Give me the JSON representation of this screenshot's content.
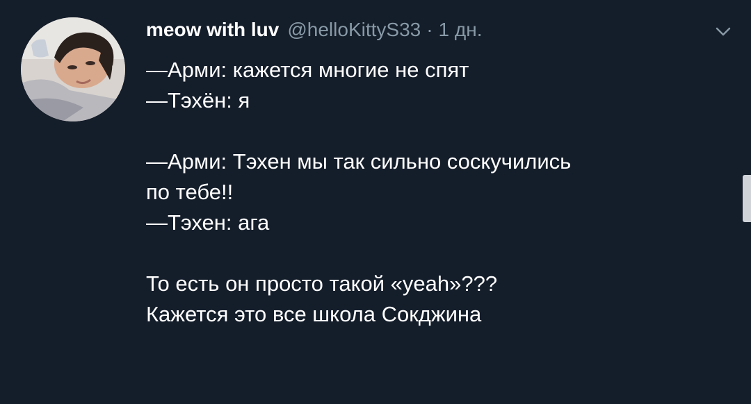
{
  "tweet": {
    "display_name": "meow with luv",
    "handle": "@helloKittyS33",
    "separator": "·",
    "timestamp": "1 дн.",
    "menu_icon": "chevron-down-icon",
    "avatar_icon": "profile-photo",
    "lines": [
      "—Арми: кажется многие не спят",
      "—Тэхён: я",
      "",
      "—Арми: Тэхен мы так сильно соскучились",
      "по тебе!!",
      "—Тэхен: ага",
      "",
      "То есть он просто такой «yeah»???",
      "Кажется это все школа Сокджина"
    ]
  },
  "colors": {
    "background": "#141d2a",
    "text": "#ffffff",
    "muted": "#8899a6",
    "scrollbar": "#d0d4d9"
  }
}
